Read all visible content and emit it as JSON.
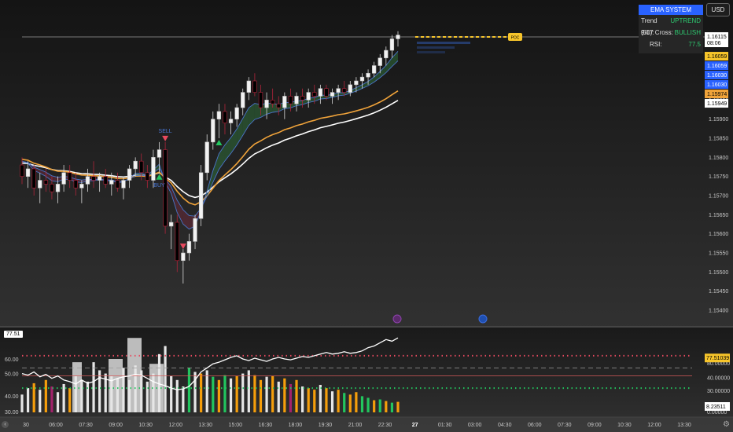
{
  "currency_button": "USD",
  "colors": {
    "up_candle": "#f2f2f2",
    "down_candle": "#000000",
    "down_border": "#b0243a",
    "ema_fast": "#4a74c9",
    "ema_orange": "#f0a33a",
    "ema_white": "#ffffff",
    "cloud_bull": "#2f6d3a",
    "cloud_bear": "#6a2a3a",
    "accent_blue": "#2962ff",
    "gold": "#f7c52b",
    "osc_green": "#22c55e",
    "osc_orange": "#f59e0b",
    "osc_magenta": "#a3226b"
  },
  "info_table": {
    "title": "EMA SYSTEM",
    "rows": [
      {
        "label": "Trend (50):",
        "value": "UPTREND"
      },
      {
        "label": "9/17 Cross:",
        "value": "BULLISH"
      },
      {
        "label": "RSI:",
        "value": "77.5"
      }
    ]
  },
  "price_labels": [
    {
      "text": "1.16115",
      "sub": "08:06",
      "style": "current"
    },
    {
      "text": "1.16059",
      "style": "gold"
    },
    {
      "text": "1.16059",
      "style": "blue"
    },
    {
      "text": "1.16030",
      "style": "blue"
    },
    {
      "text": "1.16030",
      "style": "blue"
    },
    {
      "text": "1.15974",
      "style": "orange"
    },
    {
      "text": "1.15949",
      "style": "white"
    }
  ],
  "osc_labels": [
    {
      "text": "77.51039",
      "style": "gold"
    },
    {
      "text": "8.23511",
      "style": "white"
    }
  ],
  "osc_value_tag": "77.51",
  "signals": {
    "sell": "SELL",
    "buy": "BUY",
    "poc": "POC"
  },
  "chart_data": [
    {
      "type": "candlestick",
      "title": "",
      "ylim": [
        1.154,
        1.1615
      ],
      "y_ticks": [
        "1.16115",
        "1.15950",
        "1.15900",
        "1.15850",
        "1.15800",
        "1.15750",
        "1.15700",
        "1.15650",
        "1.15600",
        "1.15550",
        "1.15500",
        "1.15450",
        "1.15400"
      ],
      "x_ticks": [
        "30",
        "06:00",
        "07:30",
        "09:00",
        "10:30",
        "12:00",
        "13:30",
        "15:00",
        "16:30",
        "18:00",
        "19:30",
        "21:00",
        "22:30",
        "27",
        "01:30",
        "03:00",
        "04:30",
        "06:00",
        "07:30",
        "09:00",
        "10:30",
        "12:00",
        "13:30"
      ],
      "candles": [
        [
          1.1578,
          1.158,
          1.1573,
          1.1575
        ],
        [
          1.1575,
          1.1579,
          1.1572,
          1.1577
        ],
        [
          1.1577,
          1.1578,
          1.157,
          1.1572
        ],
        [
          1.1572,
          1.1576,
          1.1568,
          1.1574
        ],
        [
          1.1574,
          1.1577,
          1.1571,
          1.1573
        ],
        [
          1.1573,
          1.1575,
          1.1569,
          1.1571
        ],
        [
          1.1571,
          1.1575,
          1.1568,
          1.1573
        ],
        [
          1.1573,
          1.1578,
          1.1571,
          1.1576
        ],
        [
          1.1576,
          1.1578,
          1.1572,
          1.1574
        ],
        [
          1.1574,
          1.1576,
          1.157,
          1.1572
        ],
        [
          1.1572,
          1.1574,
          1.1568,
          1.1573
        ],
        [
          1.1573,
          1.1577,
          1.1571,
          1.1575
        ],
        [
          1.1575,
          1.1579,
          1.1572,
          1.1574
        ],
        [
          1.1574,
          1.1576,
          1.1571,
          1.1575
        ],
        [
          1.1575,
          1.1577,
          1.1572,
          1.1573
        ],
        [
          1.1573,
          1.1576,
          1.157,
          1.1574
        ],
        [
          1.1574,
          1.1576,
          1.1571,
          1.1572
        ],
        [
          1.1572,
          1.1575,
          1.1569,
          1.1574
        ],
        [
          1.1574,
          1.1578,
          1.1572,
          1.1577
        ],
        [
          1.1577,
          1.158,
          1.1575,
          1.1579
        ],
        [
          1.1579,
          1.1581,
          1.1574,
          1.1576
        ],
        [
          1.1576,
          1.1578,
          1.1572,
          1.1574
        ],
        [
          1.1574,
          1.1582,
          1.1572,
          1.158
        ],
        [
          1.158,
          1.1584,
          1.1576,
          1.1582
        ],
        [
          1.1582,
          1.1584,
          1.156,
          1.1562
        ],
        [
          1.1562,
          1.1565,
          1.1556,
          1.1563
        ],
        [
          1.1563,
          1.1565,
          1.155,
          1.1553
        ],
        [
          1.1553,
          1.1556,
          1.1547,
          1.1555
        ],
        [
          1.1555,
          1.156,
          1.1553,
          1.1558
        ],
        [
          1.1558,
          1.1565,
          1.1556,
          1.1564
        ],
        [
          1.1564,
          1.1578,
          1.1562,
          1.1576
        ],
        [
          1.1576,
          1.1586,
          1.1574,
          1.1584
        ],
        [
          1.1584,
          1.1592,
          1.1582,
          1.159
        ],
        [
          1.159,
          1.1594,
          1.1585,
          1.1592
        ],
        [
          1.1592,
          1.1594,
          1.1586,
          1.1589
        ],
        [
          1.1589,
          1.1592,
          1.1586,
          1.159
        ],
        [
          1.159,
          1.1594,
          1.1588,
          1.1593
        ],
        [
          1.1593,
          1.1598,
          1.1591,
          1.1597
        ],
        [
          1.1597,
          1.1601,
          1.1595,
          1.16
        ],
        [
          1.16,
          1.1602,
          1.1596,
          1.1597
        ],
        [
          1.1597,
          1.1599,
          1.1591,
          1.1593
        ],
        [
          1.1593,
          1.1597,
          1.159,
          1.1595
        ],
        [
          1.1595,
          1.1598,
          1.1593,
          1.1594
        ],
        [
          1.1594,
          1.1596,
          1.1591,
          1.1593
        ],
        [
          1.1593,
          1.1597,
          1.159,
          1.1596
        ],
        [
          1.1596,
          1.1598,
          1.1592,
          1.1594
        ],
        [
          1.1594,
          1.1597,
          1.1592,
          1.1596
        ],
        [
          1.1596,
          1.1598,
          1.1593,
          1.1595
        ],
        [
          1.1595,
          1.1598,
          1.1593,
          1.1597
        ],
        [
          1.1597,
          1.1599,
          1.1594,
          1.1596
        ],
        [
          1.1596,
          1.1599,
          1.1594,
          1.1598
        ],
        [
          1.1598,
          1.1599,
          1.1595,
          1.1596
        ],
        [
          1.1596,
          1.1598,
          1.1594,
          1.1597
        ],
        [
          1.1597,
          1.1599,
          1.1595,
          1.1598
        ],
        [
          1.1598,
          1.16,
          1.1596,
          1.1597
        ],
        [
          1.1597,
          1.16,
          1.1596,
          1.1599
        ],
        [
          1.1599,
          1.1601,
          1.1597,
          1.16
        ],
        [
          1.16,
          1.1602,
          1.1598,
          1.1601
        ],
        [
          1.1601,
          1.1603,
          1.1599,
          1.1602
        ],
        [
          1.1602,
          1.1605,
          1.1601,
          1.1604
        ],
        [
          1.1604,
          1.1607,
          1.1602,
          1.1606
        ],
        [
          1.1606,
          1.1609,
          1.1604,
          1.1608
        ],
        [
          1.1608,
          1.1612,
          1.1606,
          1.1611
        ],
        [
          1.1611,
          1.1613,
          1.1609,
          1.1612
        ]
      ],
      "ema_fast_start": 1.1579,
      "ema_orange_start": 1.15795,
      "ema_white_start": 1.15785,
      "ema_orange_end": 1.15974,
      "ema_white_end": 1.15949,
      "level_line": 1.16115,
      "poc": 1.16115,
      "sell_at": 24,
      "buy_at": [
        23,
        33
      ],
      "red_marker_at": 27
    },
    {
      "type": "bar",
      "title": "",
      "ylim": [
        0,
        100
      ],
      "y_ticks": [
        "80.00000",
        "40.00000",
        "30.00000",
        "0.00000"
      ],
      "left_ticks": [
        "60.00",
        "50.00",
        "40.00",
        "30.00"
      ],
      "line_values": [
        48,
        46,
        50,
        44,
        47,
        42,
        45,
        40,
        38,
        35,
        40,
        36,
        38,
        43,
        41,
        39,
        42,
        44,
        45,
        47,
        46,
        42,
        38,
        35,
        33,
        30,
        28,
        29,
        32,
        40,
        50,
        55,
        60,
        62,
        65,
        68,
        70,
        66,
        64,
        67,
        65,
        63,
        66,
        68,
        66,
        65,
        67,
        69,
        68,
        70,
        72,
        74,
        72,
        73,
        75,
        73,
        74,
        76,
        80,
        82,
        86,
        90,
        88,
        92
      ],
      "bar_values": [
        22,
        30,
        36,
        28,
        40,
        32,
        25,
        35,
        30,
        45,
        40,
        38,
        62,
        52,
        48,
        45,
        42,
        55,
        40,
        58,
        52,
        38,
        48,
        72,
        82,
        45,
        40,
        32,
        55,
        50,
        48,
        52,
        44,
        40,
        46,
        42,
        45,
        48,
        52,
        46,
        40,
        44,
        45,
        38,
        42,
        35,
        40,
        32,
        30,
        28,
        34,
        30,
        26,
        28,
        24,
        22,
        25,
        20,
        18,
        15,
        16,
        14,
        12,
        13
      ],
      "bar_kinds": [
        "w",
        "w",
        "o",
        "w",
        "o",
        "m",
        "w",
        "w",
        "o",
        "w",
        "w",
        "w",
        "w",
        "w",
        "w",
        "w",
        "w",
        "w",
        "w",
        "w",
        "w",
        "w",
        "w",
        "w",
        "w",
        "w",
        "w",
        "w",
        "g",
        "w",
        "o",
        "w",
        "g",
        "o",
        "g",
        "w",
        "o",
        "w",
        "w",
        "o",
        "o",
        "w",
        "o",
        "w",
        "o",
        "m",
        "o",
        "w",
        "o",
        "o",
        "w",
        "o",
        "w",
        "o",
        "g",
        "o",
        "o",
        "g",
        "g",
        "o",
        "g",
        "o",
        "g",
        "o"
      ],
      "levels": {
        "upper": 70,
        "mid": 55,
        "lower": 45,
        "bottom": 30
      }
    }
  ]
}
